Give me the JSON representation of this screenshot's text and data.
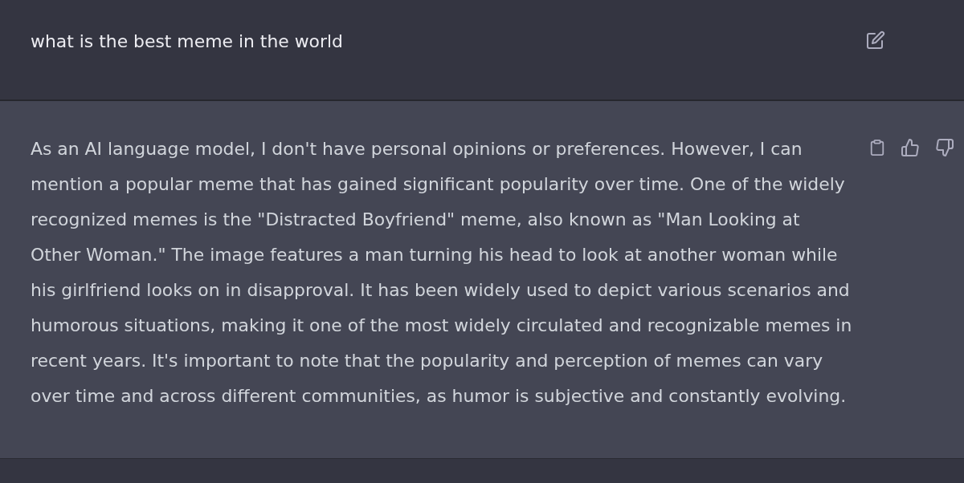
{
  "user_message": {
    "text": "what is the best meme in the world"
  },
  "response": {
    "text": "As an AI language model, I don't have personal opinions or preferences. However, I can mention a popular meme that has gained significant popularity over time. One of the widely recognized memes is the \"Distracted Boyfriend\" meme, also known as \"Man Looking at Other Woman.\" The image features a man turning his head to look at another woman while his girlfriend looks on in disapproval. It has been widely used to depict various scenarios and humorous situations, making it one of the most widely circulated and recognizable memes in recent years. It's important to note that the popularity and perception of memes can vary over time and across different communities, as humor is subjective and constantly evolving."
  }
}
